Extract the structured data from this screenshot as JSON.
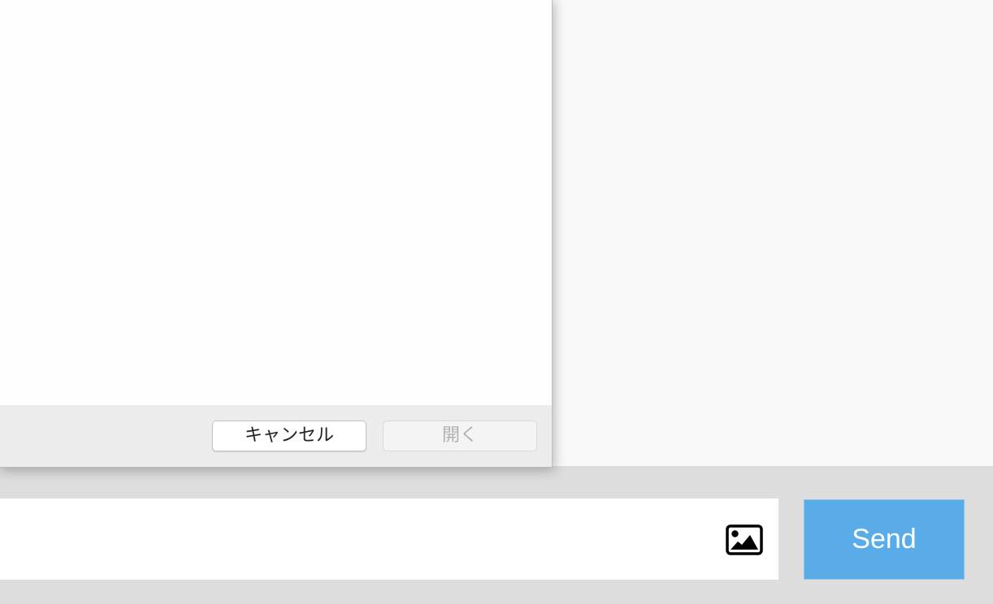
{
  "dialog": {
    "cancel_label": "キャンセル",
    "open_label": "開く"
  },
  "composer": {
    "image_icon": "image-icon",
    "send_label": "Send"
  },
  "colors": {
    "send_button": "#5aace8",
    "background": "#dddddd",
    "chat_area": "#f9f9f9",
    "dialog_footer": "#ececec"
  }
}
